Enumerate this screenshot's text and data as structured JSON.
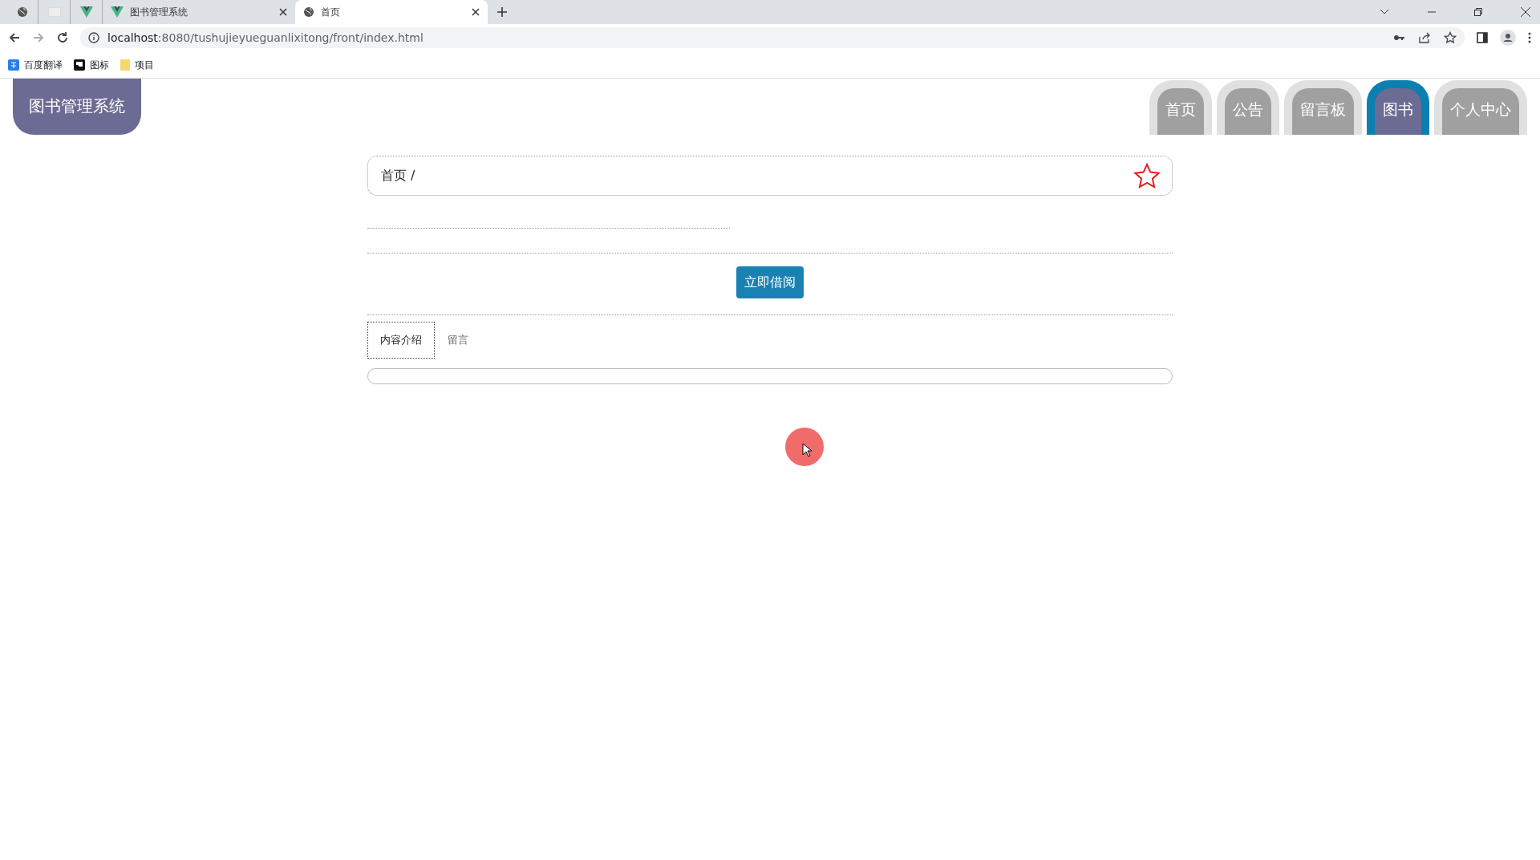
{
  "browser": {
    "tabs": [
      {
        "title": "图书管理系统",
        "selected": false
      },
      {
        "title": "首页",
        "selected": true
      }
    ],
    "url": {
      "host": "localhost",
      "rest": ":8080/tushujieyueguanlixitong/front/index.html"
    },
    "bookmarks": [
      {
        "label": "百度翻译",
        "kind": "translate"
      },
      {
        "label": "图标",
        "kind": "flag"
      },
      {
        "label": "项目",
        "kind": "folder"
      }
    ]
  },
  "logo": "图书管理系统",
  "nav": [
    {
      "label": "首页",
      "selected": false
    },
    {
      "label": "公告",
      "selected": false
    },
    {
      "label": "留言板",
      "selected": false
    },
    {
      "label": "图书",
      "selected": true
    },
    {
      "label": "个人中心",
      "selected": false
    }
  ],
  "breadcrumb": "首页 /",
  "favorite": {
    "on": false
  },
  "borrow_button": "立即借阅",
  "detail_tabs": [
    {
      "label": "内容介绍",
      "selected": true
    },
    {
      "label": "留言",
      "selected": false
    }
  ]
}
